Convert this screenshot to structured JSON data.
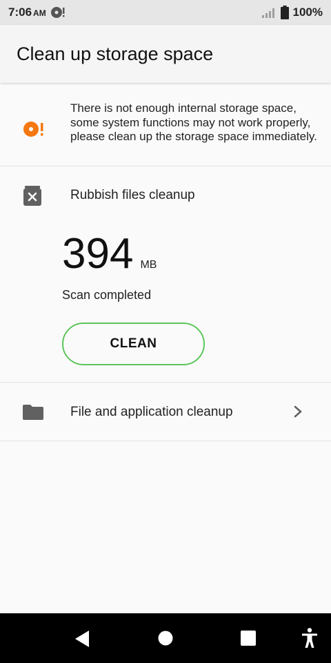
{
  "status_bar": {
    "time": "7:06",
    "ampm": "AM",
    "battery": "100%",
    "icons": [
      "debug-icon",
      "signal-icon",
      "battery-icon"
    ]
  },
  "header": {
    "title": "Clean up storage space"
  },
  "warning": {
    "icon": "warning-icon",
    "text": "There is not enough internal storage space, some system functions may not work properly, please clean up the storage space immediately."
  },
  "rubbish": {
    "icon": "trash-icon",
    "label": "Rubbish files cleanup",
    "size_value": "394",
    "size_unit": "MB",
    "status": "Scan completed",
    "button_label": "CLEAN"
  },
  "file_cleanup": {
    "icon": "folder-icon",
    "label": "File and application cleanup"
  },
  "nav_bar": {
    "items": [
      "back-icon",
      "home-icon",
      "recents-icon",
      "accessibility-icon"
    ]
  },
  "colors": {
    "accent_orange": "#f5780f",
    "button_border_green": "#5cc65a",
    "icon_gray": "#616161"
  }
}
